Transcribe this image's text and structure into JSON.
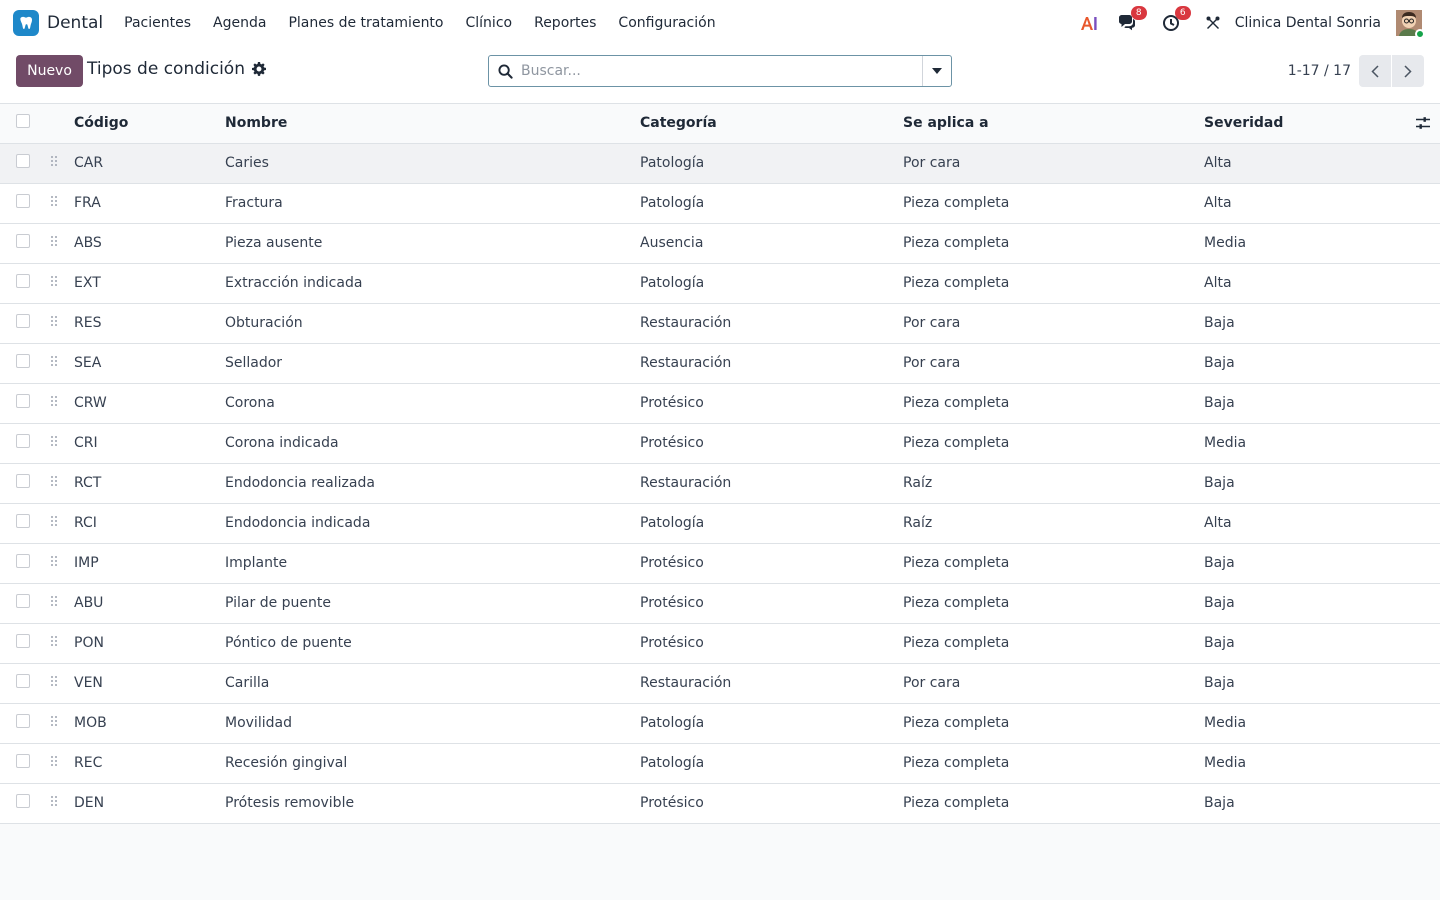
{
  "app": {
    "name": "Dental",
    "logo_icon": "tooth-icon",
    "brand_color": "#1e88c9",
    "accent_color": "#714b67"
  },
  "menu": [
    {
      "label": "Pacientes"
    },
    {
      "label": "Agenda"
    },
    {
      "label": "Planes de tratamiento"
    },
    {
      "label": "Clínico"
    },
    {
      "label": "Reportes"
    },
    {
      "label": "Configuración"
    }
  ],
  "systray": {
    "ai_icon": "ai-icon",
    "messages_icon": "chat-icon",
    "messages_count": "8",
    "activities_icon": "clock-icon",
    "activities_count": "6",
    "debug_icon": "tools-icon",
    "company": "Clinica Dental Sonria",
    "badge_color": "#d9373f"
  },
  "control": {
    "new_label": "Nuevo",
    "title": "Tipos de condición",
    "search_placeholder": "Buscar...",
    "pager": "1-17 / 17"
  },
  "table": {
    "columns": {
      "code": "Código",
      "name": "Nombre",
      "category": "Categoría",
      "applies_to": "Se aplica a",
      "severity": "Severidad"
    },
    "rows": [
      {
        "code": "CAR",
        "name": "Caries",
        "category": "Patología",
        "applies_to": "Por cara",
        "severity": "Alta"
      },
      {
        "code": "FRA",
        "name": "Fractura",
        "category": "Patología",
        "applies_to": "Pieza completa",
        "severity": "Alta"
      },
      {
        "code": "ABS",
        "name": "Pieza ausente",
        "category": "Ausencia",
        "applies_to": "Pieza completa",
        "severity": "Media"
      },
      {
        "code": "EXT",
        "name": "Extracción indicada",
        "category": "Patología",
        "applies_to": "Pieza completa",
        "severity": "Alta"
      },
      {
        "code": "RES",
        "name": "Obturación",
        "category": "Restauración",
        "applies_to": "Por cara",
        "severity": "Baja"
      },
      {
        "code": "SEA",
        "name": "Sellador",
        "category": "Restauración",
        "applies_to": "Por cara",
        "severity": "Baja"
      },
      {
        "code": "CRW",
        "name": "Corona",
        "category": "Protésico",
        "applies_to": "Pieza completa",
        "severity": "Baja"
      },
      {
        "code": "CRI",
        "name": "Corona indicada",
        "category": "Protésico",
        "applies_to": "Pieza completa",
        "severity": "Media"
      },
      {
        "code": "RCT",
        "name": "Endodoncia realizada",
        "category": "Restauración",
        "applies_to": "Raíz",
        "severity": "Baja"
      },
      {
        "code": "RCI",
        "name": "Endodoncia indicada",
        "category": "Patología",
        "applies_to": "Raíz",
        "severity": "Alta"
      },
      {
        "code": "IMP",
        "name": "Implante",
        "category": "Protésico",
        "applies_to": "Pieza completa",
        "severity": "Baja"
      },
      {
        "code": "ABU",
        "name": "Pilar de puente",
        "category": "Protésico",
        "applies_to": "Pieza completa",
        "severity": "Baja"
      },
      {
        "code": "PON",
        "name": "Póntico de puente",
        "category": "Protésico",
        "applies_to": "Pieza completa",
        "severity": "Baja"
      },
      {
        "code": "VEN",
        "name": "Carilla",
        "category": "Restauración",
        "applies_to": "Por cara",
        "severity": "Baja"
      },
      {
        "code": "MOB",
        "name": "Movilidad",
        "category": "Patología",
        "applies_to": "Pieza completa",
        "severity": "Media"
      },
      {
        "code": "REC",
        "name": "Recesión gingival",
        "category": "Patología",
        "applies_to": "Pieza completa",
        "severity": "Media"
      },
      {
        "code": "DEN",
        "name": "Prótesis removible",
        "category": "Protésico",
        "applies_to": "Pieza completa",
        "severity": "Baja"
      }
    ]
  }
}
